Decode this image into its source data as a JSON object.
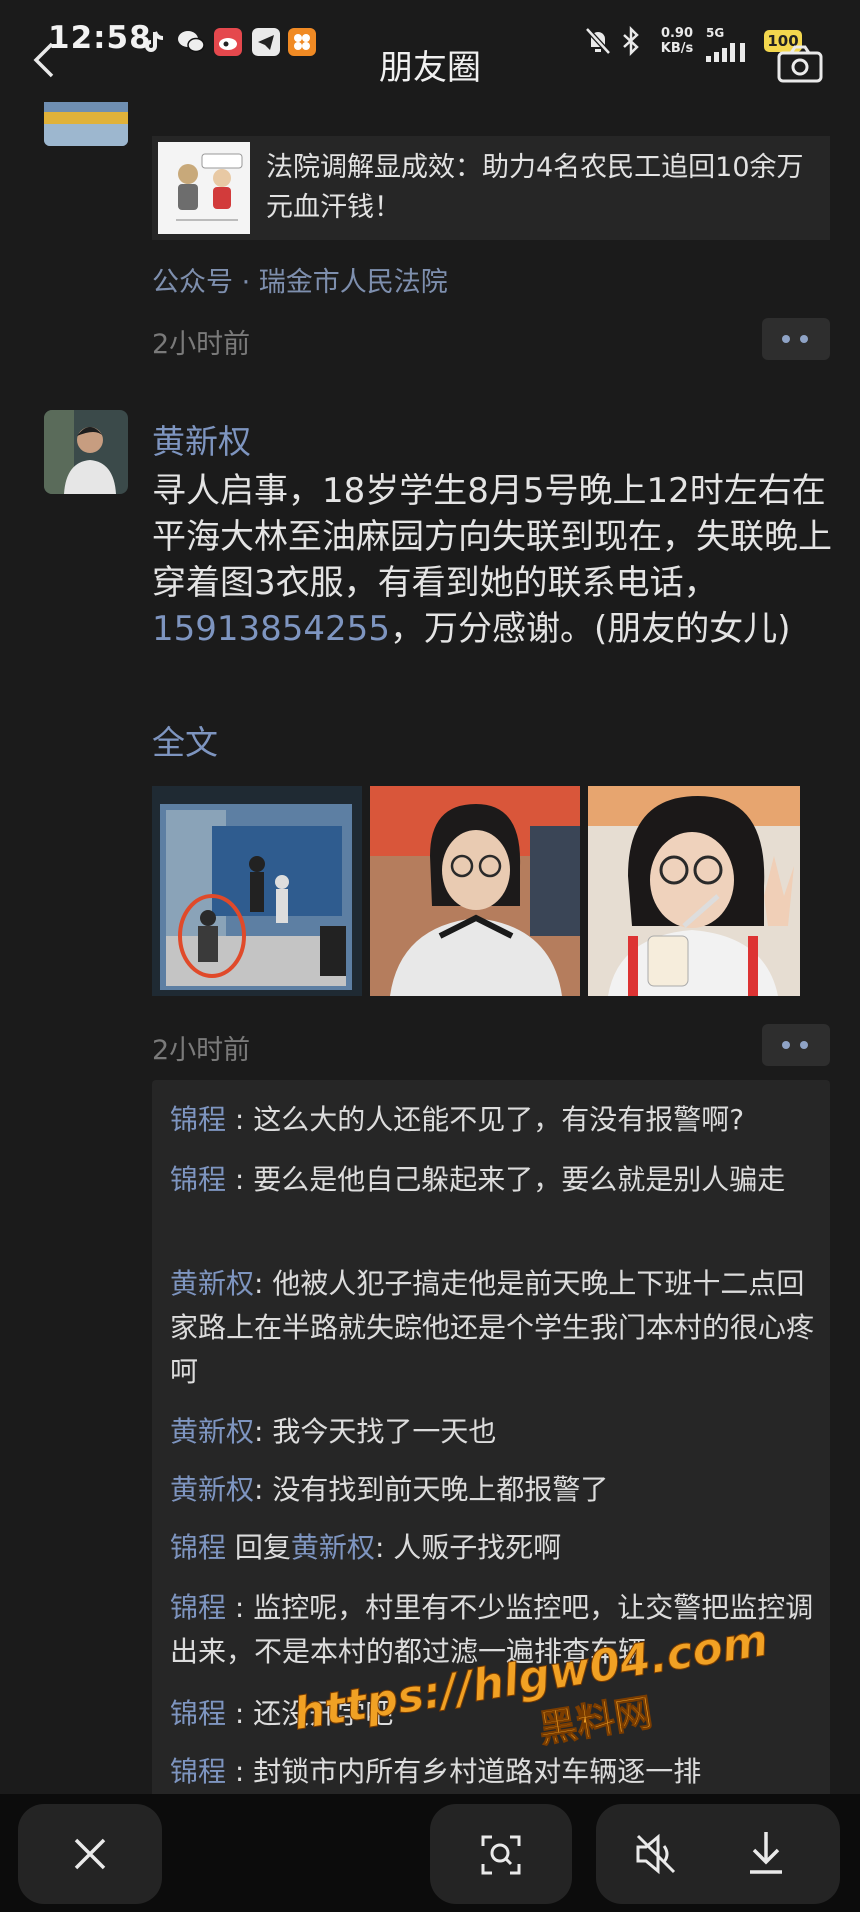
{
  "status_bar": {
    "time": "12:58",
    "net_speed_value": "0.90",
    "net_speed_unit": "KB/s",
    "network": "5G",
    "battery": "100"
  },
  "nav": {
    "title": "朋友圈"
  },
  "prev_post": {
    "share_title": "法院调解显成效：助力4名农民工追回10余万元血汗钱！",
    "source": "公众号 · 瑞金市人民法院",
    "time": "2小时前"
  },
  "post": {
    "author": "黄新权",
    "text_before_phone": "寻人启事，18岁学生8月5号晚上12时左右在平海大林至油麻园方向失联到现在，失联晚上穿着图3衣服，有看到她的联系电话，\n",
    "phone": "15913854255",
    "text_after_phone": "，万分感谢。(朋友的女儿)",
    "full_text_link": "全文",
    "time": "2小时前",
    "photo_count": 3
  },
  "comments": [
    {
      "name": "锦程",
      "sep": " : ",
      "text": "这么大的人还能不见了，有没有报警啊?"
    },
    {
      "name": "锦程",
      "sep": " : ",
      "text": "要么是他自己躲起来了，要么就是别人骗走"
    },
    {
      "name": "黄新权",
      "sep": ": ",
      "text": "他被人犯子搞走他是前天晚上下班十二点回家路上在半路就失踪他还是个学生我门本村的很心疼呵"
    },
    {
      "name": "黄新权",
      "sep": ": ",
      "text": "我今天找了一天也"
    },
    {
      "name": "黄新权",
      "sep": ": ",
      "text": "没有找到前天晚上都报警了"
    },
    {
      "name": "锦程",
      "reply_word": " 回复",
      "reply_to": "黄新权",
      "sep": ": ",
      "text": "人贩子找死啊"
    },
    {
      "name": "锦程",
      "sep": " : ",
      "text": "监控呢，村里有不少监控吧，让交警把监控调出来，不是本村的都过滤一遍排查车辆"
    },
    {
      "name": "锦程",
      "sep": " : ",
      "text": "还没开学吧"
    },
    {
      "name": "锦程",
      "sep": " : ",
      "text": "封锁市内所有乡村道路对车辆逐一排"
    }
  ],
  "watermark": {
    "url": "https://hlgw04.com",
    "name": "黑料网"
  },
  "icons": [
    "back-icon",
    "camera-icon",
    "close-icon",
    "image-search-icon",
    "mute-icon",
    "download-icon"
  ],
  "colors": {
    "background": "#1b1b1b",
    "link": "#7e95c0",
    "card": "#262626",
    "watermark": "#f1a124"
  }
}
